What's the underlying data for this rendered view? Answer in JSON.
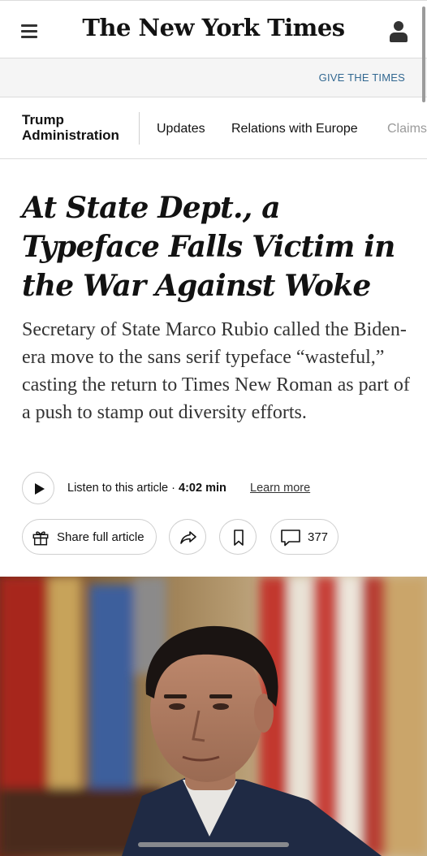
{
  "header": {
    "logo": "The New York Times",
    "menu_icon": "hamburger-menu-icon",
    "account_icon": "person-icon"
  },
  "promo": {
    "give_label": "GIVE THE TIMES"
  },
  "section_nav": {
    "title": "Trump Administration",
    "links": [
      "Updates",
      "Relations with Europe",
      "Claims"
    ]
  },
  "article": {
    "headline": "At State Dept., a Typeface Falls Victim in the War Against Woke",
    "summary": "Secretary of State Marco Rubio called the Biden-era move to the sans serif typeface “wasteful,” casting the return to Times New Roman as part of a push to stamp out diversity efforts.",
    "listen": {
      "label": "Listen to this article",
      "separator": "·",
      "duration": "4:02 min",
      "learn_more": "Learn more"
    },
    "actions": {
      "share_label": "Share full article",
      "comment_count": "377"
    }
  },
  "colors": {
    "link_blue": "#326891",
    "text": "#121212"
  }
}
